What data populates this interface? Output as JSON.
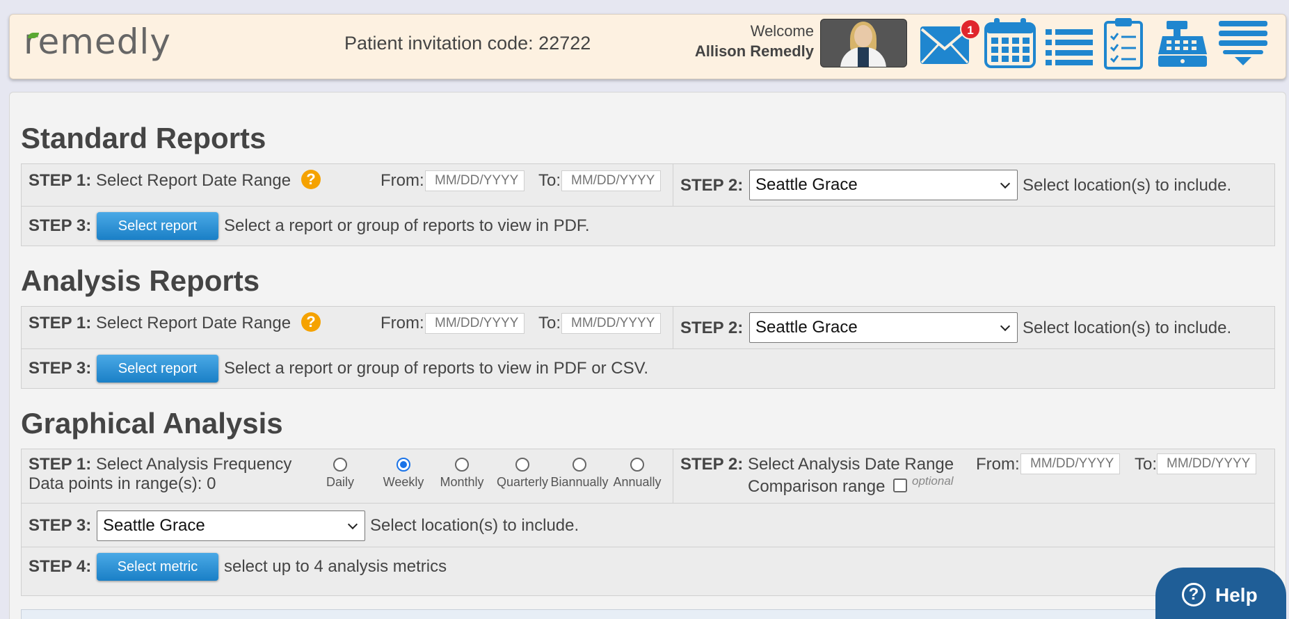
{
  "header": {
    "logo": "remedly",
    "invite_label": "Patient invitation code: 22722",
    "welcome": "Welcome",
    "user_name": "Allison Remedly",
    "message_badge": "1",
    "colors": {
      "icon": "#1f86cf",
      "badge": "#e0252c",
      "bar": "#fdf1e1"
    }
  },
  "standard": {
    "title": "Standard Reports",
    "step1_label": "STEP 1:",
    "step1_text": "Select Report Date Range",
    "from_label": "From:",
    "to_label": "To:",
    "from_placeholder": "MM/DD/YYYY",
    "to_placeholder": "MM/DD/YYYY",
    "step2_label": "STEP 2:",
    "location": "Seattle Grace",
    "step2_text": "Select location(s) to include.",
    "step3_label": "STEP 3:",
    "button": "Select report",
    "step3_text": "Select a report or group of reports to view in PDF."
  },
  "analysis": {
    "title": "Analysis Reports",
    "step1_label": "STEP 1:",
    "step1_text": "Select Report Date Range",
    "from_label": "From:",
    "to_label": "To:",
    "from_placeholder": "MM/DD/YYYY",
    "to_placeholder": "MM/DD/YYYY",
    "step2_label": "STEP 2:",
    "location": "Seattle Grace",
    "step2_text": "Select location(s) to include.",
    "step3_label": "STEP 3:",
    "button": "Select report",
    "step3_text": "Select a report or group of reports to view in PDF or CSV."
  },
  "graphical": {
    "title": "Graphical Analysis",
    "step1_label": "STEP 1:",
    "step1_text": "Select Analysis Frequency",
    "data_points": "Data points in range(s): 0",
    "frequencies": [
      "Daily",
      "Weekly",
      "Monthly",
      "Quarterly",
      "Biannually",
      "Annually"
    ],
    "selected_frequency": "Weekly",
    "step2_label": "STEP 2:",
    "step2_text": "Select Analysis Date Range",
    "from_label": "From:",
    "to_label": "To:",
    "from_placeholder": "MM/DD/YYYY",
    "to_placeholder": "MM/DD/YYYY",
    "comparison_label": "Comparison range",
    "optional_label": "optional",
    "step3_label": "STEP 3:",
    "location": "Seattle Grace",
    "step3_text": "Select location(s) to include.",
    "step4_label": "STEP 4:",
    "button": "Select metric",
    "step4_text": "select up to 4 analysis metrics"
  },
  "help": {
    "label": "Help"
  }
}
